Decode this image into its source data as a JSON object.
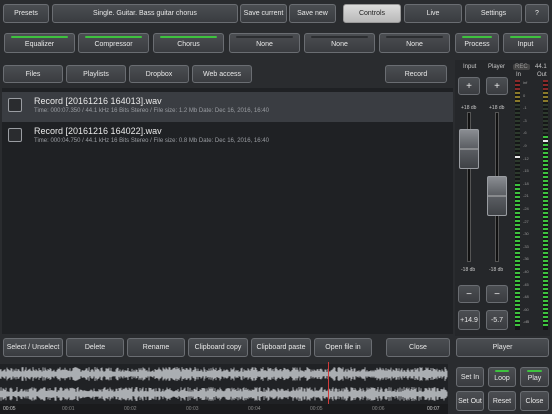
{
  "top_bar": {
    "presets": "Presets",
    "preset_name": "Single. Guitar. Bass guitar chorus",
    "save_current": "Save current",
    "save_new": "Save new",
    "controls": "Controls",
    "live": "Live",
    "settings": "Settings",
    "help": "?"
  },
  "effects": [
    {
      "label": "Equalizer",
      "active": true
    },
    {
      "label": "Compressor",
      "active": true
    },
    {
      "label": "Chorus",
      "active": true
    },
    {
      "label": "None",
      "active": false
    },
    {
      "label": "None",
      "active": false
    },
    {
      "label": "None",
      "active": false
    },
    {
      "label": "Process",
      "active": true
    },
    {
      "label": "Input",
      "active": true
    }
  ],
  "source_tabs": {
    "files": "Files",
    "playlists": "Playlists",
    "dropbox": "Dropbox",
    "web_access": "Web access",
    "record": "Record"
  },
  "files": [
    {
      "title": "Record [20161216 164013].wav",
      "info": "Time: 000:07.350 / 44.1 kHz 16 Bits Stereo / File size: 1.2 Mb Date: Dec 16, 2016, 16:40",
      "selected": true
    },
    {
      "title": "Record [20161216 164022].wav",
      "info": "Time: 000:04.750 / 44.1 kHz 16 Bits Stereo / File size: 0.8 Mb Date: Dec 16, 2016, 16:40",
      "selected": false
    }
  ],
  "file_actions": {
    "select": "Select / Unselect",
    "delete": "Delete",
    "rename": "Rename",
    "clip_copy": "Clipboard copy",
    "clip_paste": "Clipboard paste",
    "open_in": "Open file in",
    "close": "Close"
  },
  "mixer": {
    "input_label": "Input",
    "player_label": "Player",
    "rec": "REC",
    "rate": "44.1",
    "in_label": "In",
    "out_label": "Out",
    "db_top": "+18 db",
    "db_bottom": "-18 db",
    "plus": "+",
    "minus": "−",
    "input_value": "+14.9",
    "player_value": "-5.7",
    "input_level": 0.85,
    "player_level": 0.42,
    "player_button": "Player",
    "meter_scale": [
      "inf",
      "0",
      "-1",
      "-3",
      "-6",
      "-9",
      "-12",
      "-15",
      "-18",
      "-21",
      "-24",
      "-27",
      "-30",
      "-33",
      "-36",
      "-40",
      "-45",
      "-48",
      "-60",
      "-dB"
    ]
  },
  "transport": {
    "set_in": "Set In",
    "loop": "Loop",
    "play": "Play",
    "set_out": "Set Out",
    "reset": "Reset",
    "close": "Close",
    "time_start": "00:05",
    "time_end": "00:07",
    "ticks": [
      "00:01",
      "00:02",
      "00:03",
      "00:04",
      "00:05",
      "00:06"
    ]
  }
}
